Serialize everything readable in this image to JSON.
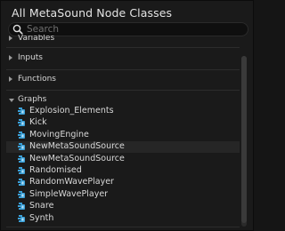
{
  "window": {
    "title": "All MetaSound Node Classes"
  },
  "search": {
    "placeholder": "Search",
    "value": ""
  },
  "categories": [
    {
      "label": "Variables",
      "expanded": false
    },
    {
      "label": "Inputs",
      "expanded": false
    },
    {
      "label": "Functions",
      "expanded": false
    },
    {
      "label": "Graphs",
      "expanded": true
    }
  ],
  "graphs": [
    {
      "label": "Explosion_Elements",
      "icon": "metasound-graph-icon"
    },
    {
      "label": "Kick",
      "icon": "metasound-graph-icon"
    },
    {
      "label": "MovingEngine",
      "icon": "metasound-graph-icon"
    },
    {
      "label": "NewMetaSoundSource",
      "icon": "metasound-graph-icon",
      "highlighted": true
    },
    {
      "label": "NewMetaSoundSource",
      "icon": "metasound-graph-icon"
    },
    {
      "label": "Randomised",
      "icon": "metasound-graph-icon"
    },
    {
      "label": "RandomWavePlayer",
      "icon": "metasound-graph-icon"
    },
    {
      "label": "SimpleWavePlayer",
      "icon": "metasound-graph-icon"
    },
    {
      "label": "Snare",
      "icon": "metasound-graph-icon"
    },
    {
      "label": "Synth",
      "icon": "metasound-graph-icon"
    }
  ],
  "colors": {
    "icon_accent": "#3aa0d8",
    "background": "#1a1a1a",
    "text": "#d8d8d8"
  }
}
